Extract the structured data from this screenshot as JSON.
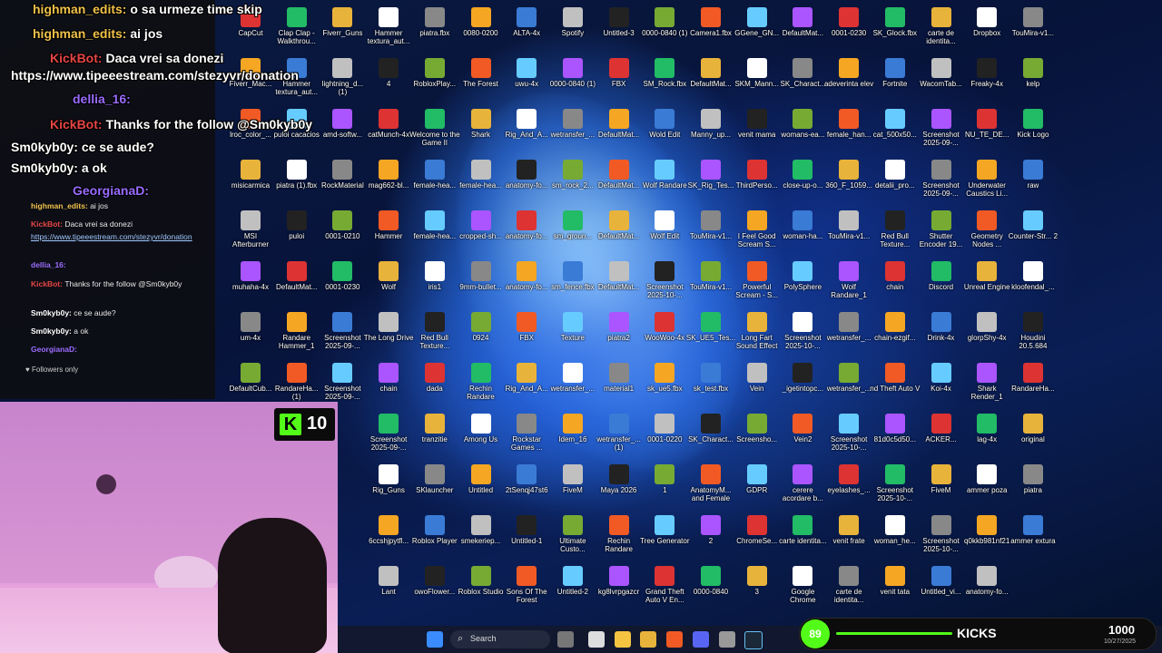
{
  "chat_big": [
    {
      "user": "highman_edits:",
      "text": "o sa urmeze time skip"
    },
    {
      "user": "highman_edits:",
      "text": "ai jos"
    },
    {
      "user": "KickBot:",
      "text": "Daca vrei sa donezi"
    },
    {
      "user": "",
      "text": "https://www.tipeeestream.com/stezyvr/donation"
    },
    {
      "user": "dellia_16:",
      "text": ""
    },
    {
      "user": "KickBot:",
      "text": "Thanks for the follow @Sm0kyb0y"
    },
    {
      "user": "Sm0kyb0y:",
      "text": "ce se aude?"
    },
    {
      "user": "Sm0kyb0y:",
      "text": "a ok"
    },
    {
      "user": "GeorgianaD:",
      "text": ""
    }
  ],
  "chat_small": [
    {
      "user": "highman_edits:",
      "text": "ai jos"
    },
    {
      "user": "KickBot:",
      "text": "Daca vrei sa donezi"
    },
    {
      "user": "",
      "text": "https://www.tipeeestream.com/stezyvr/donation"
    },
    {
      "user": "dellia_16:",
      "text": ""
    },
    {
      "user": "KickBot:",
      "text": "Thanks for the follow @Sm0kyb0y"
    },
    {
      "user": "Sm0kyb0y:",
      "text": "ce se aude?"
    },
    {
      "user": "Sm0kyb0y:",
      "text": "a ok"
    },
    {
      "user": "GeorgianaD:",
      "text": ""
    }
  ],
  "followers_label": "Followers only",
  "kick_badge_count": "10",
  "kick_bar": {
    "circle": "89",
    "label": "KICKS",
    "value": "1000",
    "date": "10/27/2025"
  },
  "taskbar": {
    "search_label": "Search"
  },
  "colors": {
    "kick_green": "#53fc18",
    "accent_blue": "#1e6cff"
  },
  "desktop_icons": [
    {
      "label": "CapCut",
      "icon": "app-icon"
    },
    {
      "label": "Clap Clap - Walkthrou...",
      "icon": "video-icon"
    },
    {
      "label": "Fiverr_Guns",
      "icon": "winrar-icon"
    },
    {
      "label": "Hammer textura_aut...",
      "icon": "texture-icon"
    },
    {
      "label": "piatra.fbx",
      "icon": "file-icon"
    },
    {
      "label": "0080-0200",
      "icon": "image-icon"
    },
    {
      "label": "ALTA-4x",
      "icon": "image-icon"
    },
    {
      "label": "Spotify",
      "icon": "spotify-icon"
    },
    {
      "label": "Untitled-3",
      "icon": "photoshop-icon"
    },
    {
      "label": "0000-0840 (1)",
      "icon": "image-icon"
    },
    {
      "label": "Camera1.fbx",
      "icon": "file-icon"
    },
    {
      "label": "GGene_GN...",
      "icon": "blender-icon"
    },
    {
      "label": "DefaultMat...",
      "icon": "image-icon"
    },
    {
      "label": "0001-0230",
      "icon": "image-icon"
    },
    {
      "label": "SK_Glock.fbx",
      "icon": "file-icon"
    },
    {
      "label": "carte de identita...",
      "icon": "chrome-icon"
    },
    {
      "label": "Dropbox",
      "icon": "file-icon"
    },
    {
      "label": "TouMira-v1...",
      "icon": "winrar-icon"
    },
    {
      "label": "Fiverr_Mac...",
      "icon": "blender-icon"
    },
    {
      "label": "Hammer textura_aut...",
      "icon": "texture-icon"
    },
    {
      "label": "lightning_d... (1)",
      "icon": "winrar-icon"
    },
    {
      "label": "4",
      "icon": "folder-icon"
    },
    {
      "label": "RobloxPlay...",
      "icon": "roblox-icon"
    },
    {
      "label": "The Forest",
      "icon": "game-icon"
    },
    {
      "label": "uwu-4x",
      "icon": "image-icon"
    },
    {
      "label": "0000-0840 (1)",
      "icon": "image-icon"
    },
    {
      "label": "FBX",
      "icon": "winrar-icon"
    },
    {
      "label": "SM_Rock.fbx",
      "icon": "file-icon"
    },
    {
      "label": "DefaultMat...",
      "icon": "image-icon"
    },
    {
      "label": "SKM_Mann...",
      "icon": "file-icon"
    },
    {
      "label": "SK_Charact...",
      "icon": "file-icon"
    },
    {
      "label": "adeverinta elev",
      "icon": "chrome-icon"
    },
    {
      "label": "Fortnite",
      "icon": "fortnite-icon"
    },
    {
      "label": "WacomTab...",
      "icon": "wacom-icon"
    }
  ],
  "desktop_icons_more": [
    "Freaky-4x",
    "kelp",
    "lroc_color_...",
    "puloi cacacios",
    "amd-softw...",
    "catMunch-4x",
    "Welcome to the Game II",
    "Shark",
    "Rig_And_A...",
    "wetransfer_...",
    "DefaultMat...",
    "Wold Edit",
    "Manny_up...",
    "venit mama",
    "womans-ea...",
    "female_han...",
    "cat_500x50...",
    "Screenshot 2025-09-...",
    "NU_TE_DE...",
    "Kick Logo",
    "misicarmica",
    "piatra (1).fbx",
    "RockMaterial",
    "mag662-bl...",
    "female-hea...",
    "female-hea...",
    "anatomy-fo...",
    "sm_rock_2...",
    "DefaultMat...",
    "Wolf Randare",
    "SK_Rig_Tes...",
    "ThirdPerso...",
    "close-up-o...",
    "360_F_1059...",
    "detalii_pro...",
    "Screenshot 2025-09-...",
    "Underwater Caustics Li...",
    "raw",
    "MSI Afterburner",
    "puloi",
    "0001-0210",
    "Hammer",
    "female-hea...",
    "cropped-sh...",
    "anatomy-fo...",
    "sm_groun...",
    "DefaultMat...",
    "Wolf Edit",
    "TouMira-v1...",
    "I Feel Good Scream S...",
    "woman-ha...",
    "TouMira-v1...",
    "Red Bull Texture...",
    "Shutter Encoder 19...",
    "Geometry Nodes ...",
    "Counter-Str... 2",
    "muhaha-4x",
    "DefaultMat...",
    "0001-0230",
    "Wolf",
    "iris1",
    "9mm-bullet...",
    "anatomy-fo...",
    "sm_fence.fbx",
    "DefaultMat...",
    "Screenshot 2025-10-...",
    "TouMira-v1...",
    "Powerful Scream - S...",
    "PolySphere",
    "Wolf Randare_1",
    "chain",
    "Discord",
    "Unreal Engine",
    "kloofendal_...",
    "um-4x",
    "Randare Hammer_1",
    "Screenshot 2025-09-...",
    "The Long Drive",
    "Red Bull Texture...",
    "0924",
    "FBX",
    "Texture",
    "piatra2",
    "WooWoo-4x",
    "SK_UE5_Tes...",
    "Long Fart Sound Effect",
    "Screenshot 2025-10-...",
    "wetransfer_...",
    "chain-ezgif...",
    "Drink-4x",
    "glorpShy-4x",
    "Houdini 20.5.684",
    "DefaultCub...",
    "RandareHa... (1)",
    "Screenshot 2025-09-...",
    "chain",
    "dada",
    "Rechin Randare",
    "Rig_And_A...",
    "wetransfer_...",
    "material1",
    "sk_ue5.fbx",
    "sk_test.fbx",
    "Vein",
    "_igetintopc...",
    "wetransfer_...",
    "nd Theft Auto V",
    "Koi-4x",
    "Shark Render_1",
    "RandareHa...",
    "Screenshot 2025-09-...",
    "tranzitie",
    "Among Us",
    "Rockstar Games ...",
    "Idem_16",
    "wetransfer_... (1)",
    "0001-0220",
    "SK_Charact...",
    "Screensho...",
    "Vein2",
    "Screenshot 2025-10-...",
    "81d0c5d50...",
    "ACKER...",
    "lag-4x",
    "original",
    "Rig_Guns",
    "SKlauncher",
    "Untitled",
    "2tSenqj47st6",
    "FiveM",
    "Maya 2026",
    "1",
    "AnatomyM... and Female",
    "GDPR",
    "cerere acordare b...",
    "eyelashes_...",
    "Screenshot 2025-10-...",
    "FiveM",
    "ammer poza",
    "piatra",
    "6ccshjpytfl...",
    "Roblox Player",
    "smekeriep...",
    "Untitled-1",
    "Ultimate Custo...",
    "Rechin Randare",
    "Tree Generator",
    "2",
    "ChromeSe...",
    "carte identita...",
    "venit frate",
    "woman_he...",
    "Screenshot 2025-10-...",
    "q0kkb981nf21",
    "ammer extura",
    "Lant",
    "owoFlower...",
    "Roblox Studio",
    "Sons Of The Forest",
    "Untitled-2",
    "kg8lvrpgazcr",
    "Grand Theft Auto V En...",
    "0000-0840",
    "3",
    "Google Chrome",
    "carte de identita...",
    "venit tata",
    "Untitled_vi...",
    "anatomy-fo..."
  ]
}
